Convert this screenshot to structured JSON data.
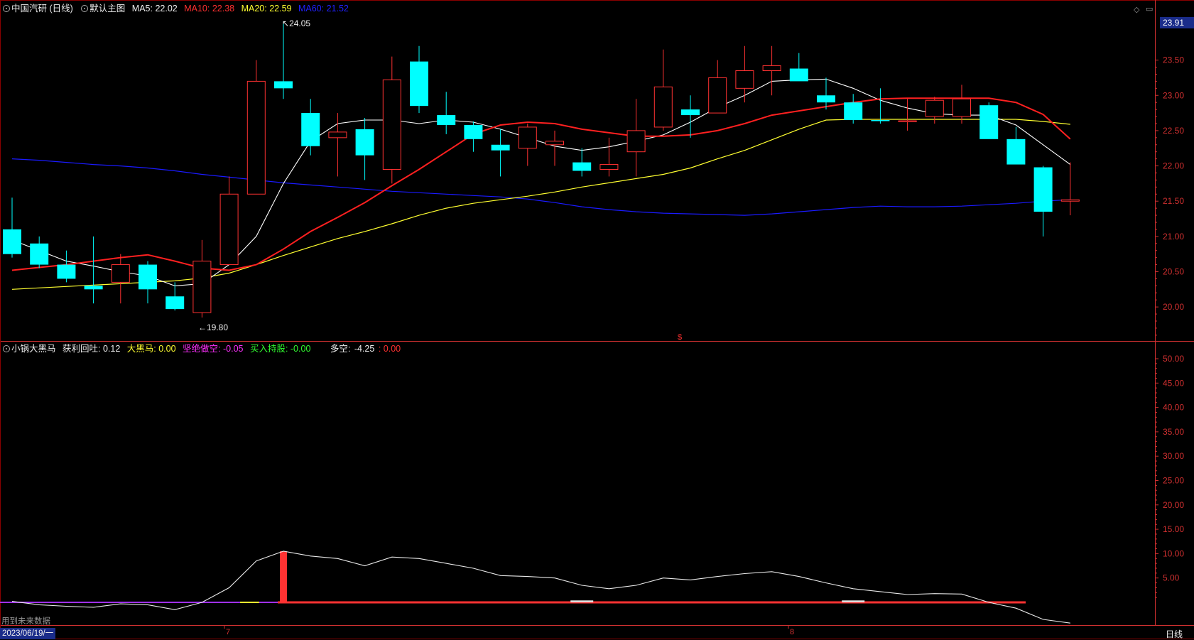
{
  "colors": {
    "up": "#ff3232",
    "down": "#00ffff",
    "ma5": "#ffffff",
    "ma10": "#ff2020",
    "ma20": "#ffff30",
    "ma60": "#1a1aff",
    "grid": "#8a0000",
    "axis": "#d03030",
    "bg": "#000000"
  },
  "main_header": {
    "stock": "中国汽研 (日线)",
    "template": "默认主图",
    "ma5": "MA5: 22.02",
    "ma10": "MA10: 22.38",
    "ma20": "MA20: 22.59",
    "ma60": "MA60: 21.52"
  },
  "last_price": "23.91",
  "high_label": "24.05",
  "low_label": "19.80",
  "marker": "$",
  "sub_header": {
    "name": "小锅大黑马",
    "hlt": "获利回吐: 0.12",
    "dhm": "大黑马: 0.00",
    "jjzk": "坚绝做空: -0.05",
    "mrcg": "买入持股: -0.00",
    "dk_label": "多空:",
    "dk_value": "-4.25",
    "dk_extra": ": 0.00"
  },
  "footer": {
    "future_note": "用到未来数据",
    "date": "2023/06/19/一",
    "month7": "7",
    "month8": "8",
    "period": "日线"
  },
  "icons": [
    "diamond-icon",
    "window-icon"
  ],
  "chart_data": {
    "type": "candlestick",
    "y_ticks": [
      "23.50",
      "23.00",
      "22.50",
      "22.00",
      "21.50",
      "21.00",
      "20.50",
      "20.00"
    ],
    "ylim": [
      19.8,
      24.1
    ],
    "sub_y_ticks": [
      "50.00",
      "45.00",
      "40.00",
      "35.00",
      "30.00",
      "25.00",
      "20.00",
      "15.00",
      "10.00",
      "5.00"
    ],
    "sub_ylim": [
      -2,
      55
    ],
    "candles": [
      [
        21.1,
        21.55,
        20.7,
        20.75
      ],
      [
        20.9,
        21.0,
        20.55,
        20.6
      ],
      [
        20.6,
        20.8,
        20.35,
        20.4
      ],
      [
        20.3,
        21.0,
        20.05,
        20.25
      ],
      [
        20.35,
        20.75,
        20.05,
        20.6
      ],
      [
        20.6,
        20.65,
        20.05,
        20.25
      ],
      [
        20.15,
        20.35,
        19.95,
        19.97
      ],
      [
        19.92,
        20.95,
        19.85,
        20.65
      ],
      [
        20.6,
        21.85,
        20.6,
        21.6
      ],
      [
        21.6,
        23.5,
        21.6,
        23.2
      ],
      [
        23.2,
        24.05,
        22.95,
        23.1
      ],
      [
        22.75,
        22.95,
        22.15,
        22.28
      ],
      [
        22.4,
        22.75,
        21.85,
        22.48
      ],
      [
        22.52,
        22.68,
        21.8,
        22.15
      ],
      [
        21.95,
        23.55,
        21.75,
        23.22
      ],
      [
        23.48,
        23.7,
        22.75,
        22.85
      ],
      [
        22.72,
        23.05,
        22.45,
        22.58
      ],
      [
        22.58,
        22.63,
        22.2,
        22.38
      ],
      [
        22.3,
        22.52,
        21.85,
        22.22
      ],
      [
        22.25,
        22.6,
        22.0,
        22.55
      ],
      [
        22.3,
        22.5,
        22.0,
        22.35
      ],
      [
        22.05,
        22.25,
        21.85,
        21.93
      ],
      [
        21.95,
        22.4,
        21.85,
        22.02
      ],
      [
        22.2,
        22.95,
        21.85,
        22.5
      ],
      [
        22.55,
        23.65,
        22.5,
        23.12
      ],
      [
        22.8,
        23.0,
        22.4,
        22.72
      ],
      [
        22.75,
        23.5,
        22.75,
        23.25
      ],
      [
        23.1,
        23.7,
        22.9,
        23.35
      ],
      [
        23.35,
        23.7,
        23.0,
        23.42
      ],
      [
        23.38,
        23.6,
        23.22,
        23.2
      ],
      [
        23.0,
        23.25,
        22.8,
        22.9
      ],
      [
        22.9,
        23.02,
        22.6,
        22.65
      ],
      [
        22.65,
        23.1,
        22.6,
        22.64
      ],
      [
        22.63,
        22.95,
        22.5,
        22.64
      ],
      [
        22.7,
        22.98,
        22.6,
        22.93
      ],
      [
        22.7,
        23.15,
        22.6,
        22.95
      ],
      [
        22.86,
        22.9,
        22.4,
        22.38
      ],
      [
        22.38,
        22.55,
        22.15,
        22.02
      ],
      [
        21.98,
        22.0,
        21.0,
        21.35
      ],
      [
        21.5,
        22.05,
        21.3,
        21.52
      ]
    ],
    "ma5": [
      20.95,
      20.8,
      20.65,
      20.58,
      20.5,
      20.44,
      20.3,
      20.33,
      20.6,
      21.0,
      21.75,
      22.35,
      22.6,
      22.65,
      22.65,
      22.6,
      22.65,
      22.62,
      22.52,
      22.4,
      22.28,
      22.22,
      22.27,
      22.35,
      22.44,
      22.62,
      22.83,
      23.0,
      23.2,
      23.22,
      23.23,
      23.1,
      22.93,
      22.82,
      22.74,
      22.72,
      22.72,
      22.58,
      22.3,
      22.02
    ],
    "ma10": [
      20.52,
      20.56,
      20.6,
      20.65,
      20.7,
      20.74,
      20.65,
      20.55,
      20.52,
      20.6,
      20.82,
      21.07,
      21.27,
      21.48,
      21.72,
      21.95,
      22.2,
      22.45,
      22.58,
      22.62,
      22.6,
      22.52,
      22.47,
      22.42,
      22.42,
      22.44,
      22.5,
      22.6,
      22.72,
      22.78,
      22.84,
      22.9,
      22.95,
      22.96,
      22.96,
      22.96,
      22.96,
      22.9,
      22.73,
      22.38
    ],
    "ma20": [
      20.25,
      20.27,
      20.29,
      20.31,
      20.33,
      20.35,
      20.37,
      20.41,
      20.48,
      20.6,
      20.73,
      20.85,
      20.97,
      21.07,
      21.18,
      21.3,
      21.4,
      21.47,
      21.52,
      21.57,
      21.63,
      21.7,
      21.76,
      21.82,
      21.88,
      21.97,
      22.1,
      22.22,
      22.37,
      22.52,
      22.65,
      22.66,
      22.66,
      22.66,
      22.66,
      22.66,
      22.66,
      22.66,
      22.63,
      22.59
    ],
    "ma60": [
      22.1,
      22.08,
      22.05,
      22.02,
      22.0,
      21.97,
      21.93,
      21.88,
      21.84,
      21.8,
      21.76,
      21.73,
      21.7,
      21.67,
      21.64,
      21.62,
      21.6,
      21.58,
      21.56,
      21.53,
      21.48,
      21.42,
      21.38,
      21.35,
      21.33,
      21.32,
      21.31,
      21.3,
      21.32,
      21.35,
      21.38,
      21.41,
      21.43,
      21.42,
      21.42,
      21.43,
      21.45,
      21.47,
      21.5,
      21.52
    ],
    "duokong": [
      0.2,
      -0.5,
      -0.8,
      -1.0,
      -0.3,
      -0.5,
      -1.5,
      0.0,
      3.0,
      8.5,
      10.5,
      9.5,
      9.0,
      7.5,
      9.3,
      9.0,
      8.0,
      7.0,
      5.5,
      5.3,
      5.0,
      3.5,
      2.8,
      3.5,
      5.0,
      4.6,
      5.3,
      5.9,
      6.3,
      5.3,
      4.0,
      2.8,
      2.2,
      1.6,
      1.8,
      1.7,
      0.0,
      -1.2,
      -3.5,
      -4.25
    ],
    "red_spike_index": 10,
    "red_spike_value": 10.5,
    "small_bar_indices": [
      21,
      31
    ],
    "small_bar_value": 0.4
  }
}
